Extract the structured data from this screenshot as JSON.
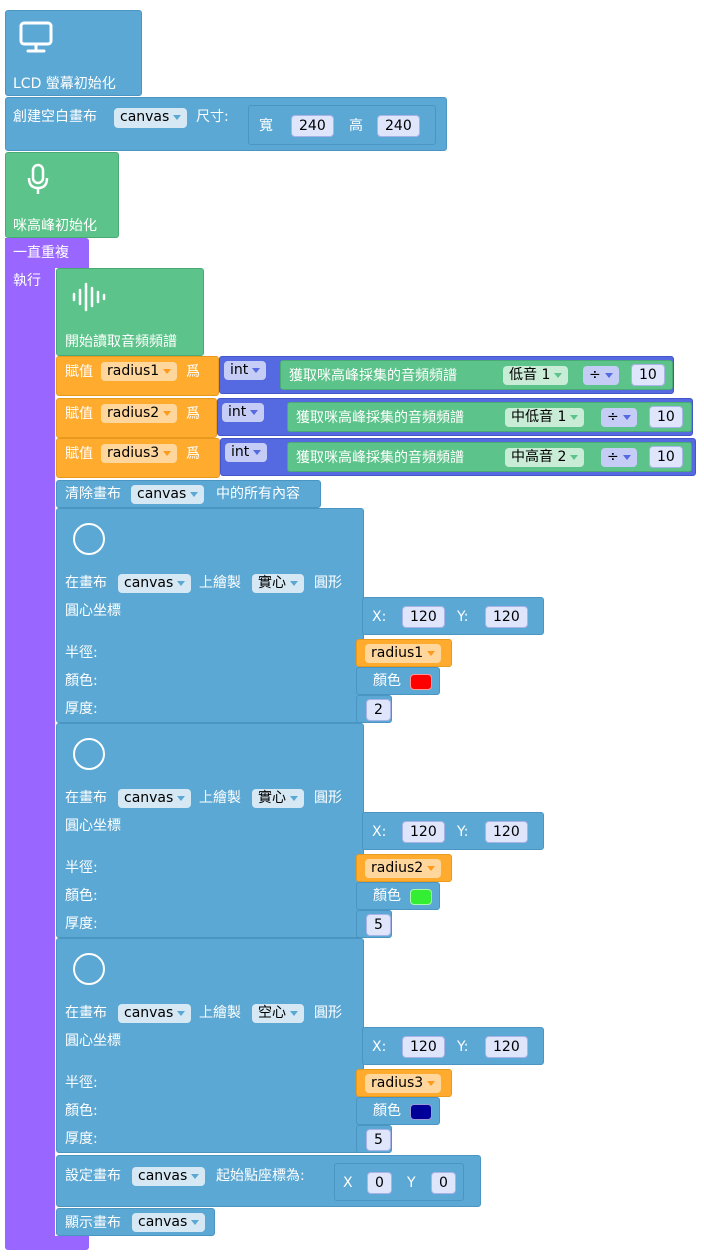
{
  "lcd_init": {
    "label": "LCD 螢幕初始化"
  },
  "create_canvas": {
    "label": "創建空白畫布",
    "canvas": "canvas",
    "size_label": "尺寸:",
    "width_label": "寬",
    "width": "240",
    "height_label": "高",
    "height": "240"
  },
  "mic_init": {
    "label": "咪高峰初始化"
  },
  "loop": {
    "repeat_label": "一直重複",
    "do_label": "執行"
  },
  "start_read": {
    "label": "開始讀取音頻頻譜"
  },
  "assigns": [
    {
      "prefix": "賦值",
      "var": "radius1",
      "as": "爲",
      "type": "int",
      "func": "獲取咪高峰採集的音頻頻譜",
      "band": "低音 1",
      "op": "÷",
      "divisor": "10"
    },
    {
      "prefix": "賦值",
      "var": "radius2",
      "as": "爲",
      "type": "int",
      "func": "獲取咪高峰採集的音頻頻譜",
      "band": "中低音 1",
      "op": "÷",
      "divisor": "10"
    },
    {
      "prefix": "賦值",
      "var": "radius3",
      "as": "爲",
      "type": "int",
      "func": "獲取咪高峰採集的音頻頻譜",
      "band": "中高音 2",
      "op": "÷",
      "divisor": "10"
    }
  ],
  "clear_canvas": {
    "prefix": "清除畫布",
    "canvas": "canvas",
    "suffix": "中的所有內容"
  },
  "circles": [
    {
      "prefix": "在畫布",
      "canvas": "canvas",
      "mid": "上繪製",
      "fill": "實心",
      "suffix": "圓形",
      "center_label": "圓心坐標",
      "x_label": "X:",
      "x": "120",
      "y_label": "Y:",
      "y": "120",
      "radius_label": "半徑:",
      "radius": "radius1",
      "color_label": "顏色:",
      "color_word": "顏色",
      "color": "#ff0000",
      "thickness_label": "厚度:",
      "thickness": "2"
    },
    {
      "prefix": "在畫布",
      "canvas": "canvas",
      "mid": "上繪製",
      "fill": "實心",
      "suffix": "圓形",
      "center_label": "圓心坐標",
      "x_label": "X:",
      "x": "120",
      "y_label": "Y:",
      "y": "120",
      "radius_label": "半徑:",
      "radius": "radius2",
      "color_label": "顏色:",
      "color_word": "顏色",
      "color": "#33ee33",
      "thickness_label": "厚度:",
      "thickness": "5"
    },
    {
      "prefix": "在畫布",
      "canvas": "canvas",
      "mid": "上繪製",
      "fill": "空心",
      "suffix": "圓形",
      "center_label": "圓心坐標",
      "x_label": "X:",
      "x": "120",
      "y_label": "Y:",
      "y": "120",
      "radius_label": "半徑:",
      "radius": "radius3",
      "color_label": "顏色:",
      "color_word": "顏色",
      "color": "#000099",
      "thickness_label": "厚度:",
      "thickness": "5"
    }
  ],
  "set_origin": {
    "prefix": "設定畫布",
    "canvas": "canvas",
    "suffix": "起始點座標為:",
    "x_label": "X",
    "x": "0",
    "y_label": "Y",
    "y": "0"
  },
  "show_canvas": {
    "prefix": "顯示畫布",
    "canvas": "canvas"
  }
}
